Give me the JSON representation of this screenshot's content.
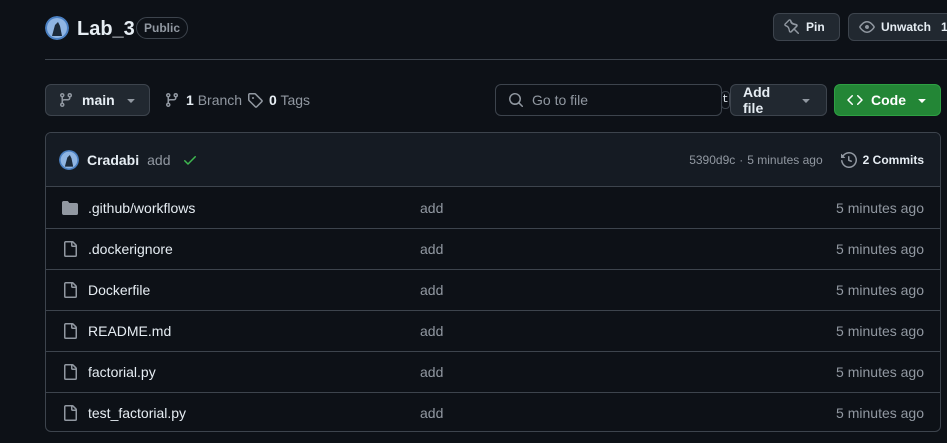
{
  "repo": {
    "name": "Lab_3",
    "visibility": "Public"
  },
  "header_actions": {
    "pin_label": "Pin",
    "watch_label": "Unwatch",
    "watch_count": "1"
  },
  "toolbar": {
    "branch_name": "main",
    "branch_count": "1",
    "branch_label": "Branch",
    "tag_count": "0",
    "tag_label": "Tags",
    "search_placeholder": "Go to file",
    "search_shortcut": "t",
    "add_file_label": "Add file",
    "code_label": "Code"
  },
  "latest_commit": {
    "author": "Cradabi",
    "message": "add",
    "status": "success",
    "hash": "5390d9c",
    "separator": "·",
    "time": "5 minutes ago",
    "commits_count_label": "2 Commits"
  },
  "files": [
    {
      "name": ".github/workflows",
      "type": "folder",
      "message": "add",
      "time": "5 minutes ago"
    },
    {
      "name": ".dockerignore",
      "type": "file",
      "message": "add",
      "time": "5 minutes ago"
    },
    {
      "name": "Dockerfile",
      "type": "file",
      "message": "add",
      "time": "5 minutes ago"
    },
    {
      "name": "README.md",
      "type": "file",
      "message": "add",
      "time": "5 minutes ago"
    },
    {
      "name": "factorial.py",
      "type": "file",
      "message": "add",
      "time": "5 minutes ago"
    },
    {
      "name": "test_factorial.py",
      "type": "file",
      "message": "add",
      "time": "5 minutes ago"
    }
  ],
  "colors": {
    "background": "#0d1117",
    "border": "#3d444d",
    "code_button": "#238636",
    "success_check": "#3fb950",
    "muted_text": "#9198a1"
  },
  "icons": {
    "branch": "git-branch-icon",
    "tag": "tag-icon",
    "search": "search-icon",
    "code": "code-icon",
    "history": "history-icon",
    "folder": "folder-icon",
    "file": "file-icon",
    "pin": "pin-icon",
    "eye": "eye-icon",
    "check": "check-icon"
  }
}
